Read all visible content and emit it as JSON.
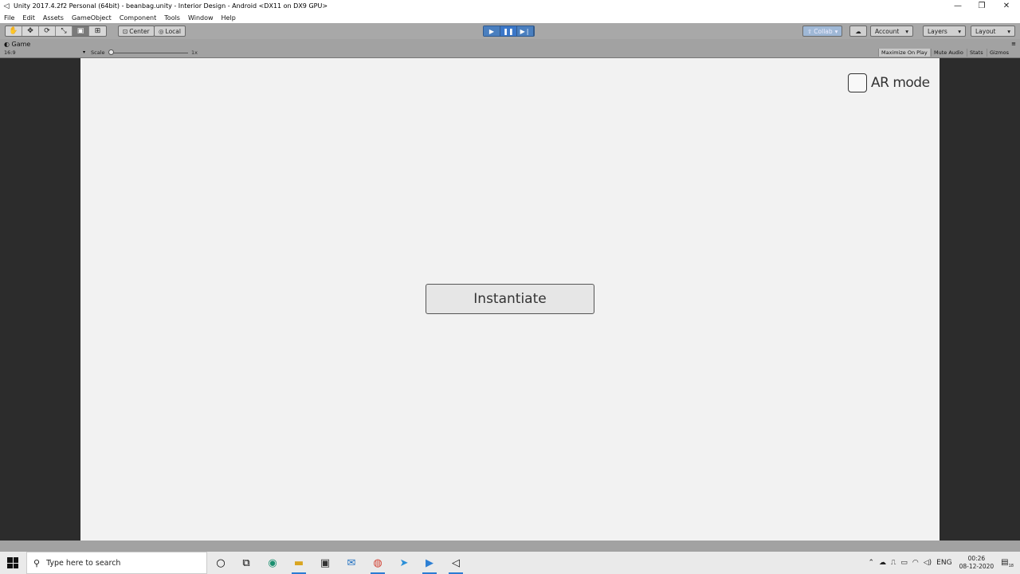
{
  "window": {
    "title": "Unity 2017.4.2f2 Personal (64bit) - beanbag.unity - Interior Design - Android <DX11 on DX9 GPU>",
    "minimize": "—",
    "restore": "❐",
    "close": "✕"
  },
  "menu": [
    "File",
    "Edit",
    "Assets",
    "GameObject",
    "Component",
    "Tools",
    "Window",
    "Help"
  ],
  "toolbar": {
    "transform_tools": [
      "hand-tool",
      "move-tool",
      "rotate-tool",
      "scale-tool",
      "rect-tool",
      "transform-tool"
    ],
    "pivot_center": "Center",
    "pivot_local": "Local",
    "collab": "Collab",
    "account": "Account",
    "layers": "Layers",
    "layout": "Layout"
  },
  "game_view": {
    "tab_label": "Game",
    "aspect": "16:9",
    "scale_label": "Scale",
    "scale_value": "1x",
    "maximize_on_play": "Maximize On Play",
    "mute_audio": "Mute Audio",
    "stats": "Stats",
    "gizmos": "Gizmos"
  },
  "scene": {
    "ar_mode_label": "AR mode",
    "ar_mode_checked": false,
    "instantiate_label": "Instantiate"
  },
  "taskbar": {
    "search_placeholder": "Type here to search",
    "language": "ENG",
    "time": "00:26",
    "date": "08-12-2020",
    "notification_count": "18"
  }
}
